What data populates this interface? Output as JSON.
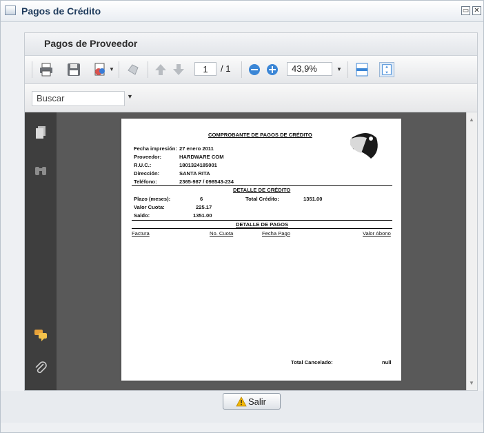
{
  "window": {
    "title": "Pagos de Crédito"
  },
  "panel": {
    "title": "Pagos de Proveedor"
  },
  "toolbar": {
    "page_current": "1",
    "page_total": "/ 1",
    "zoom": "43,9%",
    "icons": [
      "print-icon",
      "save-icon",
      "export-icon",
      "export-dropdown-icon",
      "tool-icon",
      "page-up-icon",
      "page-down-icon",
      "zoom-out-icon",
      "zoom-in-icon",
      "fit-width-icon",
      "fit-page-icon"
    ]
  },
  "search": {
    "selected": "Buscar"
  },
  "sidebar": {
    "icons": [
      "pages-icon",
      "binoculars-icon",
      "comments-icon",
      "attachment-icon"
    ]
  },
  "document": {
    "title": "COMPROBANTE DE PAGOS DE CRÉDITO",
    "fields": [
      {
        "label": "Fecha impresión:",
        "value": "27 enero 2011"
      },
      {
        "label": "Proveedor:",
        "value": "HARDWARE COM"
      },
      {
        "label": "R.U.C.:",
        "value": "1801324185001"
      },
      {
        "label": "Dirección:",
        "value": "SANTA RITA"
      },
      {
        "label": "Teléfono:",
        "value": "2365-987 / 098543-234"
      }
    ],
    "credit_section_title": "DETALLE DE CRÉDITO",
    "credit": {
      "plazo_label": "Plazo (meses):",
      "plazo_value": "6",
      "total_label": "Total Crédito:",
      "total_value": "1351.00",
      "cuota_label": "Valor Cuota:",
      "cuota_value": "225.17",
      "saldo_label": "Saldo:",
      "saldo_value": "1351.00"
    },
    "payments_section_title": "DETALLE DE PAGOS",
    "payment_columns": [
      "Factura",
      "No. Cuota",
      "Fecha Pago",
      "Valor Abono"
    ],
    "total_cancelado_label": "Total Cancelado:",
    "total_cancelado_value": "null"
  },
  "footer": {
    "exit_label": "Salir"
  },
  "colors": {
    "accent": "#1f3b5c",
    "viewer_bg": "#595959",
    "sidebar_bg": "#3e3e3e"
  }
}
